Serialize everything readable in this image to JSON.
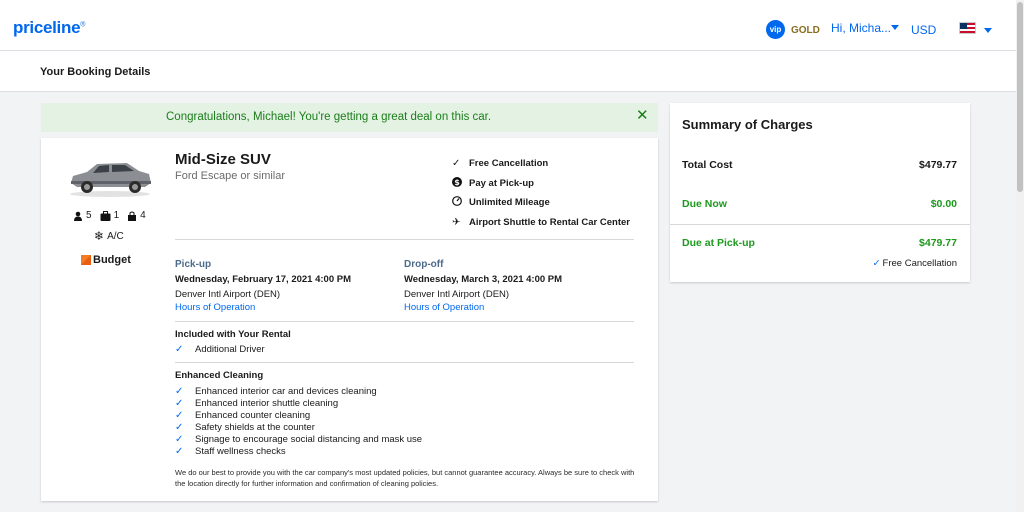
{
  "header": {
    "logo": "priceline",
    "vip": "vip",
    "tier": "GOLD",
    "user": "Hi, Micha...",
    "currency": "USD"
  },
  "subheader": {
    "title": "Your Booking Details"
  },
  "banner": {
    "text": "Congratulations, Michael! You're getting a great deal on this car."
  },
  "car": {
    "title": "Mid-Size SUV",
    "subtitle": "Ford Escape or similar",
    "passengers": "5",
    "bags_large": "1",
    "bags_small": "4",
    "ac": "A/C",
    "vendor": "Budget"
  },
  "features": [
    "Free Cancellation",
    "Pay at Pick-up",
    "Unlimited Mileage",
    "Airport Shuttle to Rental Car Center"
  ],
  "pickup": {
    "label": "Pick-up",
    "date": "Wednesday, February 17, 2021 4:00 PM",
    "place": "Denver Intl Airport (DEN)",
    "link": "Hours of Operation"
  },
  "dropoff": {
    "label": "Drop-off",
    "date": "Wednesday, March 3, 2021 4:00 PM",
    "place": "Denver Intl Airport (DEN)",
    "link": "Hours of Operation"
  },
  "included": {
    "title": "Included with Your Rental",
    "items": [
      "Additional Driver"
    ]
  },
  "cleaning": {
    "title": "Enhanced Cleaning",
    "items": [
      "Enhanced interior car and devices cleaning",
      "Enhanced interior shuttle cleaning",
      "Enhanced counter cleaning",
      "Safety shields at the counter",
      "Signage to encourage social distancing and mask use",
      "Staff wellness checks"
    ]
  },
  "disclaimer": "We do our best to provide you with the car company's most updated policies, but cannot guarantee accuracy. Always be sure to check with the location directly for further information and confirmation of cleaning policies.",
  "summary": {
    "title": "Summary of Charges",
    "total_label": "Total Cost",
    "total_value": "$479.77",
    "due_now_label": "Due Now",
    "due_now_value": "$0.00",
    "due_pickup_label": "Due at Pick-up",
    "due_pickup_value": "$479.77",
    "cancellation": "Free Cancellation"
  },
  "colors": {
    "brand": "#0068ef",
    "success": "#1d9a1d",
    "banner_bg": "#e4f2e4"
  }
}
